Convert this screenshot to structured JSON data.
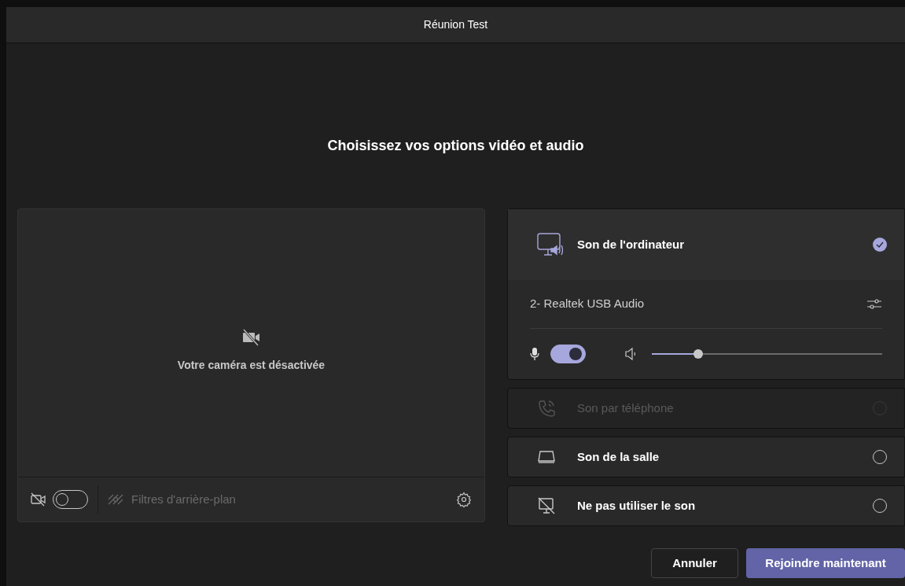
{
  "window": {
    "title": "Réunion Test"
  },
  "heading": "Choisissez vos options vidéo et audio",
  "camera": {
    "message": "Votre caméra est désactivée",
    "on": false,
    "filters": {
      "label": "Filtres d'arrière-plan",
      "disabled": true
    }
  },
  "audio_options": [
    {
      "kind": "computer",
      "label": "Son de l'ordinateur",
      "selected": true,
      "disabled": false,
      "device": "2- Realtek USB Audio",
      "mic_on": true,
      "volume": {
        "level": 0.2
      }
    },
    {
      "kind": "phone",
      "label": "Son par téléphone",
      "selected": false,
      "disabled": true
    },
    {
      "kind": "room",
      "label": "Son de la salle",
      "selected": false,
      "disabled": false
    },
    {
      "kind": "none",
      "label": "Ne pas utiliser le son",
      "selected": false,
      "disabled": false
    }
  ],
  "buttons": [
    {
      "kind": "secondary",
      "label": "Annuler"
    },
    {
      "kind": "primary",
      "label": "Rejoindre maintenant"
    }
  ]
}
